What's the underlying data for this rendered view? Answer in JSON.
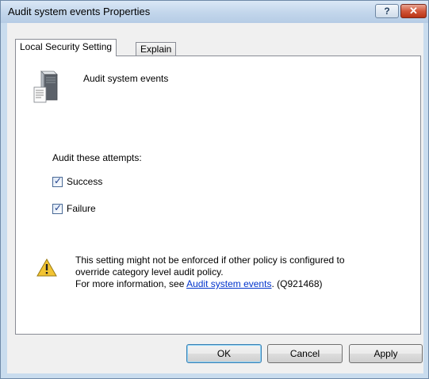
{
  "window": {
    "title": "Audit system events Properties",
    "help_label": "?",
    "close_label": "✕"
  },
  "tabs": [
    {
      "label": "Local Security Setting",
      "selected": true
    },
    {
      "label": "Explain",
      "selected": false
    }
  ],
  "policy": {
    "icon": "server-icon",
    "name": "Audit system events"
  },
  "audit": {
    "heading": "Audit these attempts:",
    "options": [
      {
        "label": "Success",
        "checked": true
      },
      {
        "label": "Failure",
        "checked": true
      }
    ]
  },
  "warning": {
    "icon": "warning-icon",
    "line1": "This setting might not be enforced if other policy is configured to",
    "line2": "override category level audit policy.",
    "line3_prefix": "For more information, see ",
    "link_text": "Audit system events",
    "line3_suffix": ". (Q921468)"
  },
  "buttons": {
    "ok": "OK",
    "cancel": "Cancel",
    "apply": "Apply"
  },
  "colors": {
    "titlebar": "#c4d7ec",
    "close_button": "#c9462a",
    "link": "#0033cc",
    "checkmark": "#21408b"
  }
}
